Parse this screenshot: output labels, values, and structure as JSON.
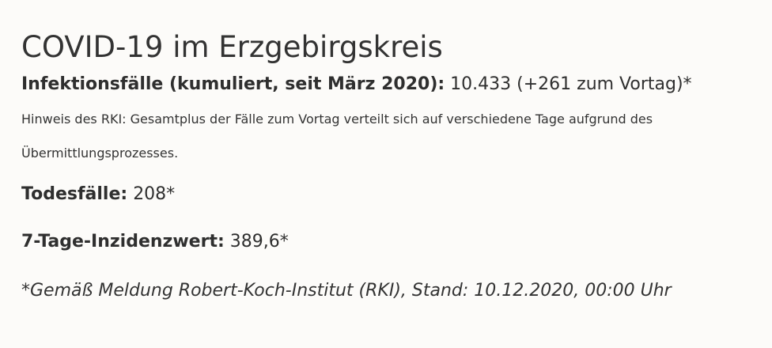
{
  "page": {
    "title": "COVID-19 im Erzgebirgskreis"
  },
  "infections": {
    "label": "Infektionsfälle (kumuliert, seit März 2020):",
    "value": "10.433 (+261 zum Vortag)*"
  },
  "hint": "Hinweis des RKI: Gesamtplus der Fälle zum Vortag verteilt sich auf verschiedene Tage aufgrund des Übermittlungsprozesses.",
  "deaths": {
    "label": "Todesfälle:",
    "value": "208*"
  },
  "incidence": {
    "label": "7-Tage-Inzidenzwert:",
    "value": "389,6*"
  },
  "source": "*Gemäß Meldung Robert-Koch-Institut (RKI), Stand: 10.12.2020, 00:00 Uhr"
}
